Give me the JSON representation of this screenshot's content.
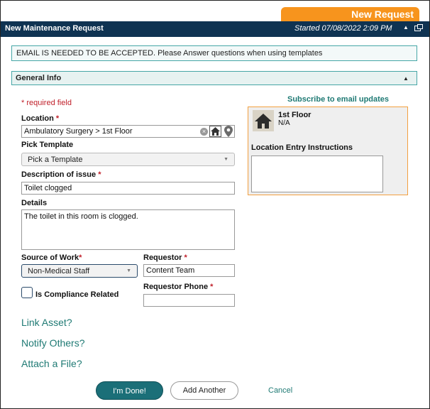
{
  "tab": {
    "label": "New Request"
  },
  "header": {
    "title": "New Maintenance Request",
    "started": "Started 07/08/2022 2:09 PM",
    "collapse_glyph": "▲"
  },
  "alert": {
    "text": "EMAIL IS NEEDED TO BE ACCEPTED. Please Answer questions when using templates"
  },
  "section": {
    "title": "General Info",
    "arrow_glyph": "▲"
  },
  "form": {
    "required_note": "* required field",
    "location": {
      "label": "Location",
      "value": "Ambulatory Surgery > 1st Floor"
    },
    "pick_template": {
      "label": "Pick Template",
      "value": "Pick a Template"
    },
    "description": {
      "label": "Description of issue",
      "value": "Toilet clogged"
    },
    "details": {
      "label": "Details",
      "value": "The toilet in this room is clogged."
    },
    "source_of_work": {
      "label": "Source of Work",
      "value": "Non-Medical Staff"
    },
    "requestor": {
      "label": "Requestor",
      "value": "Content Team"
    },
    "requestor_phone": {
      "label": "Requestor Phone",
      "value": ""
    },
    "compliance": {
      "label": "Is Compliance Related",
      "checked": false
    },
    "required_star": "*"
  },
  "location_card": {
    "subscribe": "Subscribe to email updates",
    "name": "1st Floor",
    "sub": "N/A",
    "entry_label": "Location Entry Instructions"
  },
  "links": {
    "link_asset": "Link Asset?",
    "notify_others": "Notify Others?",
    "attach_file": "Attach a File?"
  },
  "buttons": {
    "done": "I'm Done!",
    "add_another": "Add Another",
    "cancel": "Cancel"
  },
  "icons": {
    "clear": "clear-icon",
    "home": "home-icon",
    "pin": "map-pin-icon",
    "dropdown": "chevron-down-icon"
  },
  "colors": {
    "orange": "#f7941d",
    "navy": "#0f3352",
    "teal": "#1b6f78",
    "link": "#1f7a74",
    "required": "#c0202a"
  }
}
